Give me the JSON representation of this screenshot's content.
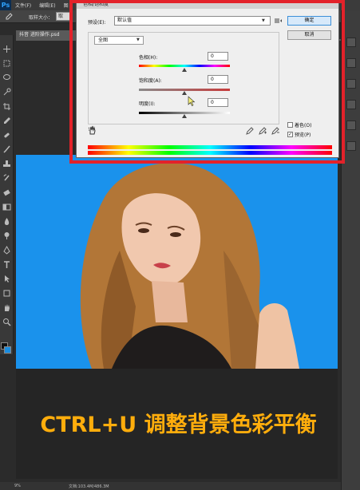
{
  "app": {
    "logo": "Ps"
  },
  "menubar": {
    "items": [
      "文件(F)",
      "编辑(E)",
      "图"
    ]
  },
  "options": {
    "sample_size_label": "取样大小：",
    "sample_size_value": "取"
  },
  "document": {
    "tab": "抖音 进阶操作.psd"
  },
  "dialog": {
    "title": "色相/饱和度",
    "preset_label": "预设(E):",
    "preset_value": "默认值",
    "ok": "确定",
    "cancel": "取消",
    "channel": "全图",
    "hue_label": "色相(H):",
    "hue_value": "0",
    "saturation_label": "饱和度(A):",
    "saturation_value": "0",
    "lightness_label": "明度(I):",
    "lightness_value": "0",
    "colorize_label": "着色(O)",
    "colorize_checked": false,
    "preview_label": "预览(P)",
    "preview_checked": true
  },
  "caption": "CTRL+U 调整背景色彩平衡",
  "status": {
    "zoom": "9%",
    "doc_info": "文档:103.4M/486.3M"
  },
  "colors": {
    "accent_red": "#e3222a",
    "photo_background": "#1a92ec",
    "caption": "#ffad0c"
  }
}
